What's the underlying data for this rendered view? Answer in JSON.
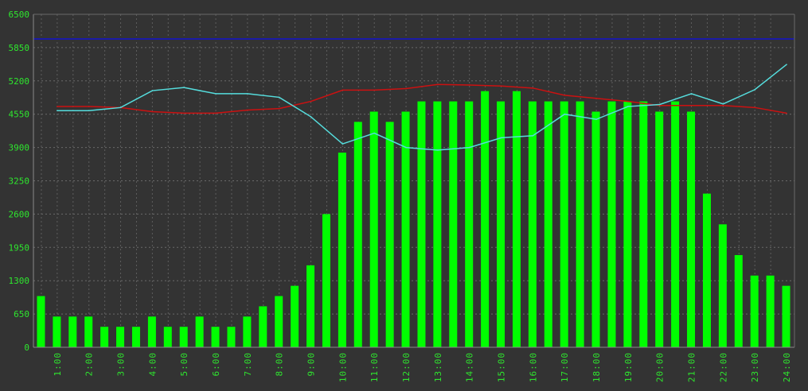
{
  "chart_data": {
    "type": "bar",
    "title": "",
    "xlabel": "",
    "ylabel": "",
    "ylim": [
      0,
      6500
    ],
    "y_ticks": [
      0,
      650,
      1300,
      1950,
      2600,
      3250,
      3900,
      4550,
      5200,
      5850,
      6500
    ],
    "x_tick_labels": [
      "1:00",
      "2:00",
      "3:00",
      "4:00",
      "5:00",
      "6:00",
      "7:00",
      "8:00",
      "9:00",
      "10:00",
      "11:00",
      "12:00",
      "13:00",
      "14:00",
      "15:00",
      "16:00",
      "17:00",
      "18:00",
      "19:00",
      "20:00",
      "21:00",
      "22:00",
      "23:00",
      "24:00"
    ],
    "grid": true,
    "series": [
      {
        "kind": "bar",
        "color": "#00ff00",
        "values": [
          1000,
          600,
          600,
          600,
          400,
          400,
          400,
          600,
          400,
          400,
          600,
          400,
          400,
          600,
          800,
          1000,
          1200,
          1600,
          2600,
          3800,
          4400,
          4600,
          4400,
          4600,
          4800,
          4800,
          4800,
          4800,
          5000,
          4800,
          5000,
          4800,
          4800,
          4800,
          4800,
          4600,
          4800,
          4800,
          4800,
          4600,
          4800,
          4600,
          3000,
          2400,
          1800,
          1400,
          1400,
          1200
        ]
      },
      {
        "kind": "line",
        "color": "#cc1111",
        "x": [
          1,
          2,
          3,
          4,
          5,
          6,
          7,
          8,
          9,
          10,
          11,
          12,
          13,
          14,
          15,
          16,
          17,
          18,
          19,
          20,
          21,
          22,
          23,
          24
        ],
        "values": [
          4700,
          4700,
          4680,
          4600,
          4570,
          4570,
          4630,
          4660,
          4800,
          5020,
          5020,
          5050,
          5130,
          5120,
          5100,
          5060,
          4920,
          4860,
          4800,
          4720,
          4720,
          4720,
          4680,
          4570
        ]
      },
      {
        "kind": "line",
        "color": "#55dddd",
        "x": [
          1,
          2,
          3,
          4,
          5,
          6,
          7,
          8,
          9,
          10,
          11,
          12,
          13,
          14,
          15,
          16,
          17,
          18,
          19,
          20,
          21,
          22,
          23,
          24
        ],
        "values": [
          4620,
          4620,
          4680,
          5010,
          5070,
          4950,
          4950,
          4880,
          4500,
          3970,
          4180,
          3900,
          3850,
          3900,
          4090,
          4130,
          4550,
          4450,
          4700,
          4740,
          4950,
          4750,
          5030,
          5520
        ]
      },
      {
        "kind": "reference",
        "color": "#1a1aa8",
        "value": 6020
      }
    ]
  }
}
